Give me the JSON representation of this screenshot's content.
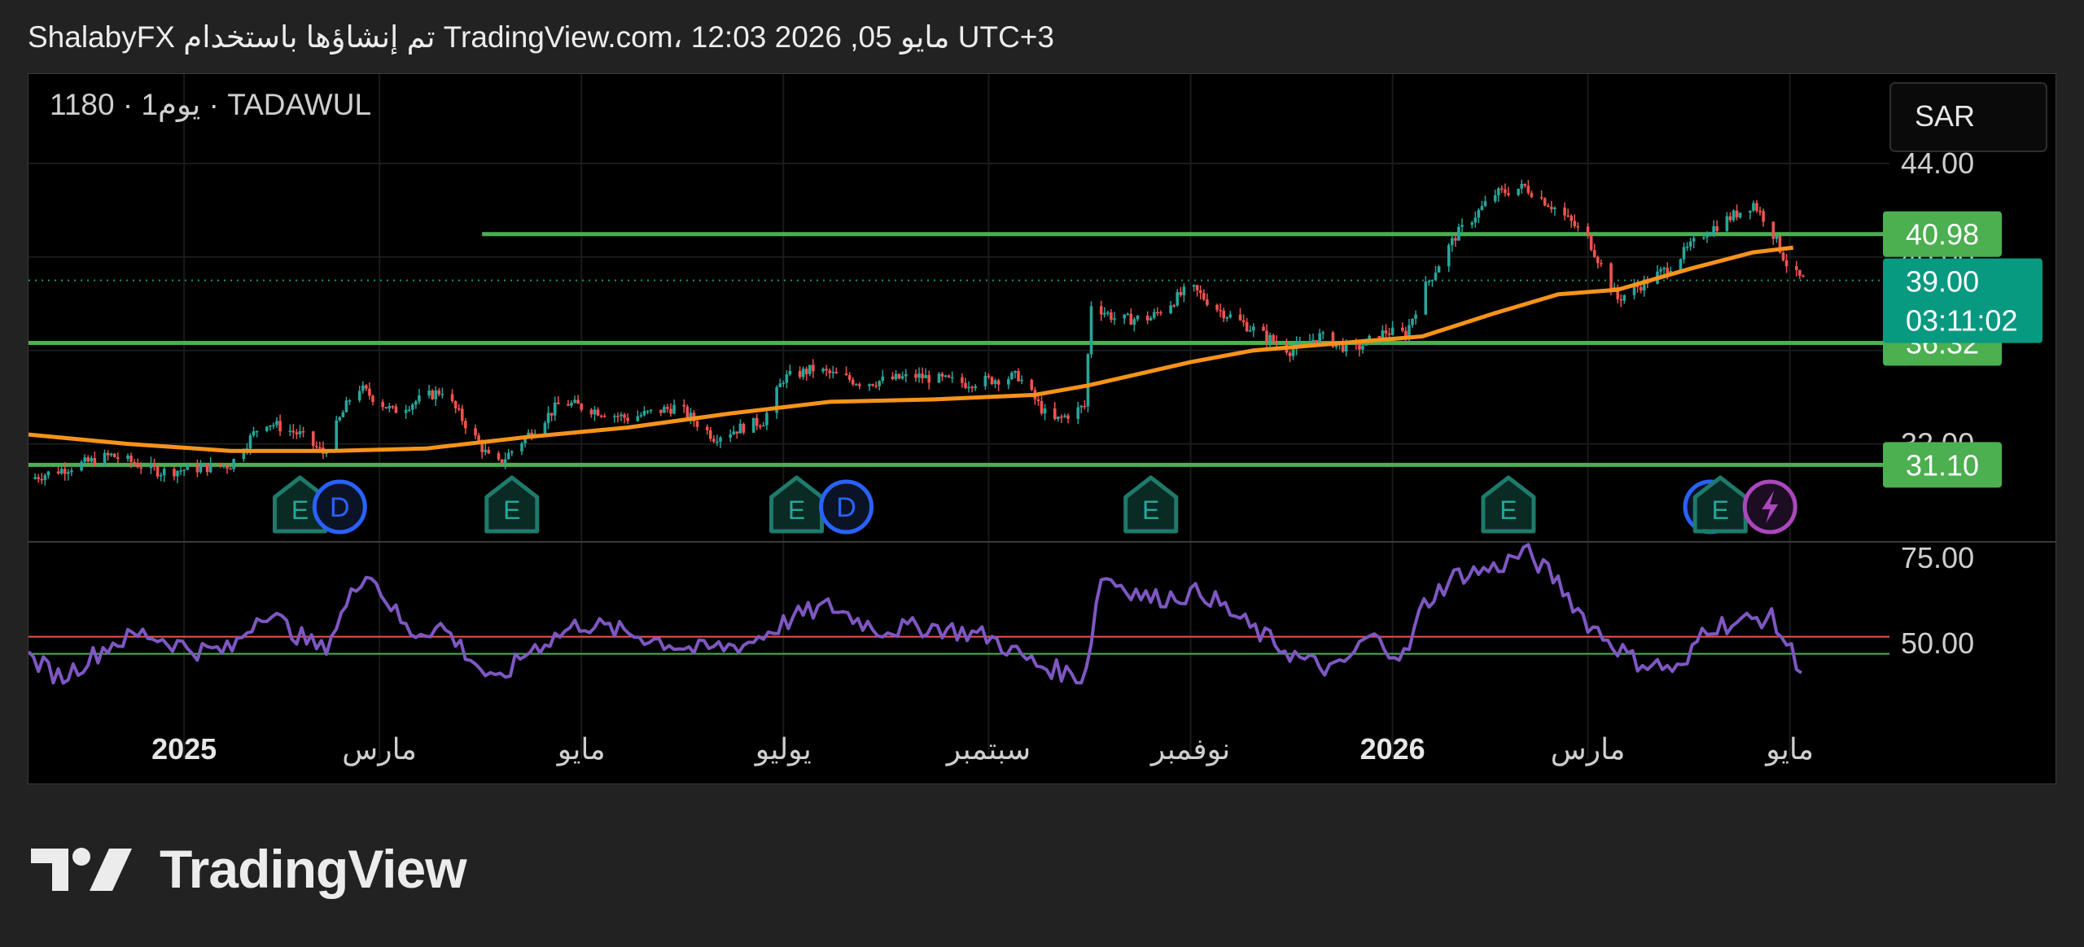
{
  "header": {
    "text": "ShalabyFX تم إنشاؤها باستخدام TradingView.com، 12:03 2026 ,05 مايو UTC+3"
  },
  "symbol_label": "1180 · 1يوم · TADAWUL",
  "currency_button": "SAR",
  "brand": {
    "name": "TradingView"
  },
  "colors": {
    "up": "#26a69a",
    "down": "#ef5350",
    "ma": "#f7931a",
    "level": "#4caf50",
    "rsi": "#7e57c2",
    "rsi_upper": "#ef5350",
    "rsi_lower": "#4caf50",
    "price_tag": "#089981"
  },
  "chart_data": {
    "type": "candlestick",
    "price_axis": {
      "ticks": [
        "44.00",
        "40.00",
        "36.00",
        "32.00"
      ],
      "range": [
        30,
        44
      ]
    },
    "current_price": {
      "value": "39.00",
      "countdown": "03:11:02"
    },
    "levels": [
      {
        "value": 40.98,
        "label": "40.98",
        "from_date": "2025-04-01"
      },
      {
        "value": 36.32,
        "label": "36.32",
        "from_date": "2024-11-15"
      },
      {
        "value": 31.1,
        "label": "31.10",
        "from_date": "2024-11-15"
      }
    ],
    "x_ticks": [
      {
        "label": "2025",
        "date": "2025-01-01",
        "bold": true
      },
      {
        "label": "مارس",
        "date": "2025-03-01"
      },
      {
        "label": "مايو",
        "date": "2025-05-01"
      },
      {
        "label": "يوليو",
        "date": "2025-07-01"
      },
      {
        "label": "سبتمبر",
        "date": "2025-09-01"
      },
      {
        "label": "نوفمبر",
        "date": "2025-11-01"
      },
      {
        "label": "2026",
        "date": "2026-01-01",
        "bold": true
      },
      {
        "label": "مارس",
        "date": "2026-03-01"
      },
      {
        "label": "مايو",
        "date": "2026-05-01"
      }
    ],
    "price_path": [
      [
        "2024-11-15",
        30.5
      ],
      [
        "2024-12-10",
        31.5
      ],
      [
        "2024-12-25",
        30.8
      ],
      [
        "2025-01-15",
        31.1
      ],
      [
        "2025-01-25",
        33.0
      ],
      [
        "2025-02-05",
        32.4
      ],
      [
        "2025-02-12",
        31.6
      ],
      [
        "2025-02-22",
        34.5
      ],
      [
        "2025-03-05",
        33.4
      ],
      [
        "2025-03-20",
        34.3
      ],
      [
        "2025-04-05",
        31.0
      ],
      [
        "2025-04-25",
        33.8
      ],
      [
        "2025-05-15",
        33.1
      ],
      [
        "2025-05-30",
        33.6
      ],
      [
        "2025-06-10",
        32.3
      ],
      [
        "2025-06-25",
        33.0
      ],
      [
        "2025-07-01",
        34.8
      ],
      [
        "2025-07-10",
        35.2
      ],
      [
        "2025-07-25",
        34.6
      ],
      [
        "2025-08-10",
        34.9
      ],
      [
        "2025-08-25",
        34.6
      ],
      [
        "2025-09-10",
        34.9
      ],
      [
        "2025-09-20",
        32.9
      ],
      [
        "2025-09-30",
        33.6
      ],
      [
        "2025-10-02",
        38.0
      ],
      [
        "2025-10-10",
        37.3
      ],
      [
        "2025-10-20",
        37.4
      ],
      [
        "2025-11-01",
        38.7
      ],
      [
        "2025-11-10",
        37.7
      ],
      [
        "2025-11-20",
        36.9
      ],
      [
        "2025-12-01",
        36.0
      ],
      [
        "2025-12-10",
        36.6
      ],
      [
        "2025-12-20",
        36.0
      ],
      [
        "2025-12-30",
        36.8
      ],
      [
        "2026-01-05",
        36.7
      ],
      [
        "2026-01-10",
        38.5
      ],
      [
        "2026-01-20",
        40.9
      ],
      [
        "2026-02-01",
        42.7
      ],
      [
        "2026-02-10",
        43.0
      ],
      [
        "2026-02-20",
        42.0
      ],
      [
        "2026-03-01",
        40.8
      ],
      [
        "2026-03-10",
        38.2
      ],
      [
        "2026-03-25",
        39.5
      ],
      [
        "2026-04-05",
        41.0
      ],
      [
        "2026-04-20",
        42.3
      ],
      [
        "2026-04-25",
        41.3
      ],
      [
        "2026-05-01",
        39.4
      ],
      [
        "2026-05-05",
        39.0
      ]
    ],
    "moving_average": {
      "points": [
        [
          "2024-11-15",
          32.4
        ],
        [
          "2024-12-15",
          32.0
        ],
        [
          "2025-01-15",
          31.7
        ],
        [
          "2025-02-15",
          31.7
        ],
        [
          "2025-03-15",
          31.8
        ],
        [
          "2025-04-15",
          32.3
        ],
        [
          "2025-05-15",
          32.7
        ],
        [
          "2025-06-15",
          33.3
        ],
        [
          "2025-07-15",
          33.8
        ],
        [
          "2025-08-15",
          33.9
        ],
        [
          "2025-09-15",
          34.1
        ],
        [
          "2025-10-01",
          34.5
        ],
        [
          "2025-11-01",
          35.5
        ],
        [
          "2025-11-20",
          36.0
        ],
        [
          "2025-12-15",
          36.3
        ],
        [
          "2026-01-10",
          36.6
        ],
        [
          "2026-02-01",
          37.6
        ],
        [
          "2026-02-20",
          38.4
        ],
        [
          "2026-03-10",
          38.6
        ],
        [
          "2026-04-01",
          39.5
        ],
        [
          "2026-04-20",
          40.2
        ],
        [
          "2026-05-02",
          40.4
        ]
      ]
    },
    "events": [
      {
        "type": "E",
        "date": "2025-02-05"
      },
      {
        "type": "D",
        "date": "2025-02-17"
      },
      {
        "type": "E",
        "date": "2025-04-10"
      },
      {
        "type": "E",
        "date": "2025-07-05"
      },
      {
        "type": "D",
        "date": "2025-07-20"
      },
      {
        "type": "E",
        "date": "2025-10-20"
      },
      {
        "type": "E",
        "date": "2026-02-05"
      },
      {
        "type": "D",
        "date": "2026-04-07"
      },
      {
        "type": "E",
        "date": "2026-04-10"
      },
      {
        "type": "split",
        "date": "2026-04-25"
      }
    ],
    "rsi": {
      "ticks": [
        "75.00",
        "50.00"
      ],
      "upper": 52,
      "lower": 47,
      "path": [
        [
          "2024-11-15",
          46
        ],
        [
          "2024-11-25",
          40
        ],
        [
          "2024-12-10",
          50
        ],
        [
          "2024-12-20",
          53
        ],
        [
          "2025-01-05",
          48
        ],
        [
          "2025-01-15",
          48
        ],
        [
          "2025-01-25",
          60
        ],
        [
          "2025-02-05",
          52
        ],
        [
          "2025-02-12",
          48
        ],
        [
          "2025-02-25",
          72
        ],
        [
          "2025-03-10",
          53
        ],
        [
          "2025-03-20",
          55
        ],
        [
          "2025-04-05",
          38
        ],
        [
          "2025-04-15",
          48
        ],
        [
          "2025-05-01",
          56
        ],
        [
          "2025-05-20",
          52
        ],
        [
          "2025-06-05",
          48
        ],
        [
          "2025-06-20",
          50
        ],
        [
          "2025-07-05",
          58
        ],
        [
          "2025-07-15",
          61
        ],
        [
          "2025-07-30",
          54
        ],
        [
          "2025-08-15",
          55
        ],
        [
          "2025-09-01",
          52
        ],
        [
          "2025-09-15",
          44
        ],
        [
          "2025-09-30",
          40
        ],
        [
          "2025-10-05",
          70
        ],
        [
          "2025-10-20",
          63
        ],
        [
          "2025-11-05",
          65
        ],
        [
          "2025-11-20",
          54
        ],
        [
          "2025-12-05",
          45
        ],
        [
          "2025-12-15",
          42
        ],
        [
          "2025-12-25",
          52
        ],
        [
          "2026-01-05",
          46
        ],
        [
          "2026-01-10",
          61
        ],
        [
          "2026-01-20",
          70
        ],
        [
          "2026-02-01",
          72
        ],
        [
          "2026-02-10",
          77
        ],
        [
          "2026-02-20",
          68
        ],
        [
          "2026-03-01",
          56
        ],
        [
          "2026-03-15",
          45
        ],
        [
          "2026-03-30",
          42
        ],
        [
          "2026-04-05",
          55
        ],
        [
          "2026-04-15",
          56
        ],
        [
          "2026-04-25",
          58
        ],
        [
          "2026-05-05",
          42
        ]
      ]
    }
  }
}
